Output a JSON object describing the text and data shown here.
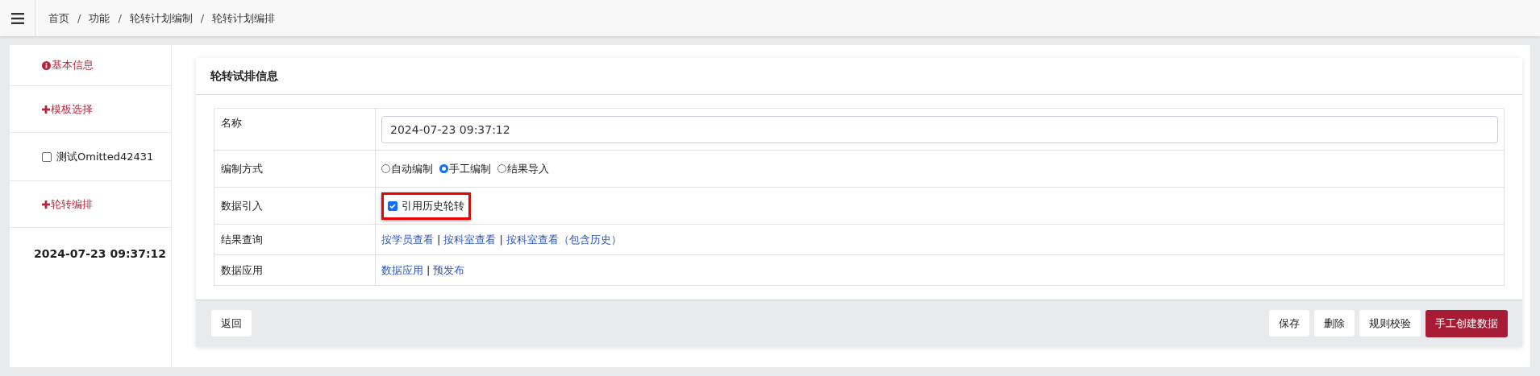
{
  "breadcrumb": [
    "首页",
    "功能",
    "轮转计划编制",
    "轮转计划编排"
  ],
  "breadcrumb_separator": "/",
  "sidebar": [
    {
      "kind": "info-link",
      "label": "基本信息"
    },
    {
      "kind": "add-link",
      "label": "模板选择"
    },
    {
      "kind": "checkbox",
      "label": "测试Omitted42431",
      "checked": false
    },
    {
      "kind": "add-link",
      "label": "轮转编排"
    },
    {
      "kind": "title",
      "label": "2024-07-23 09:37:12"
    }
  ],
  "card": {
    "title": "轮转试排信息",
    "rows": [
      {
        "kind": "input",
        "label": "名称",
        "value": "2024-07-23 09:37:12"
      },
      {
        "kind": "radio",
        "label": "编制方式",
        "options": [
          {
            "label": "自动编制",
            "selected": false
          },
          {
            "label": "手工编制",
            "selected": true
          },
          {
            "label": "结果导入",
            "selected": false
          }
        ]
      },
      {
        "kind": "checkbox",
        "label": "数据引入",
        "option": "引用历史轮转",
        "checked": true,
        "highlighted": true
      },
      {
        "kind": "links",
        "label": "结果查询",
        "separator": "|",
        "links": [
          "按学员查看",
          "按科室查看",
          "按科室查看（包含历史）"
        ]
      },
      {
        "kind": "links",
        "label": "数据应用",
        "separator": "|",
        "links": [
          "数据应用",
          "预发布"
        ]
      }
    ],
    "footer_left": [
      {
        "label": "返回"
      }
    ],
    "footer_right": [
      {
        "label": "保存",
        "kind": "default"
      },
      {
        "label": "删除",
        "kind": "default"
      },
      {
        "label": "规则校验",
        "kind": "default"
      },
      {
        "label": "手工创建数据",
        "kind": "primary"
      }
    ]
  }
}
